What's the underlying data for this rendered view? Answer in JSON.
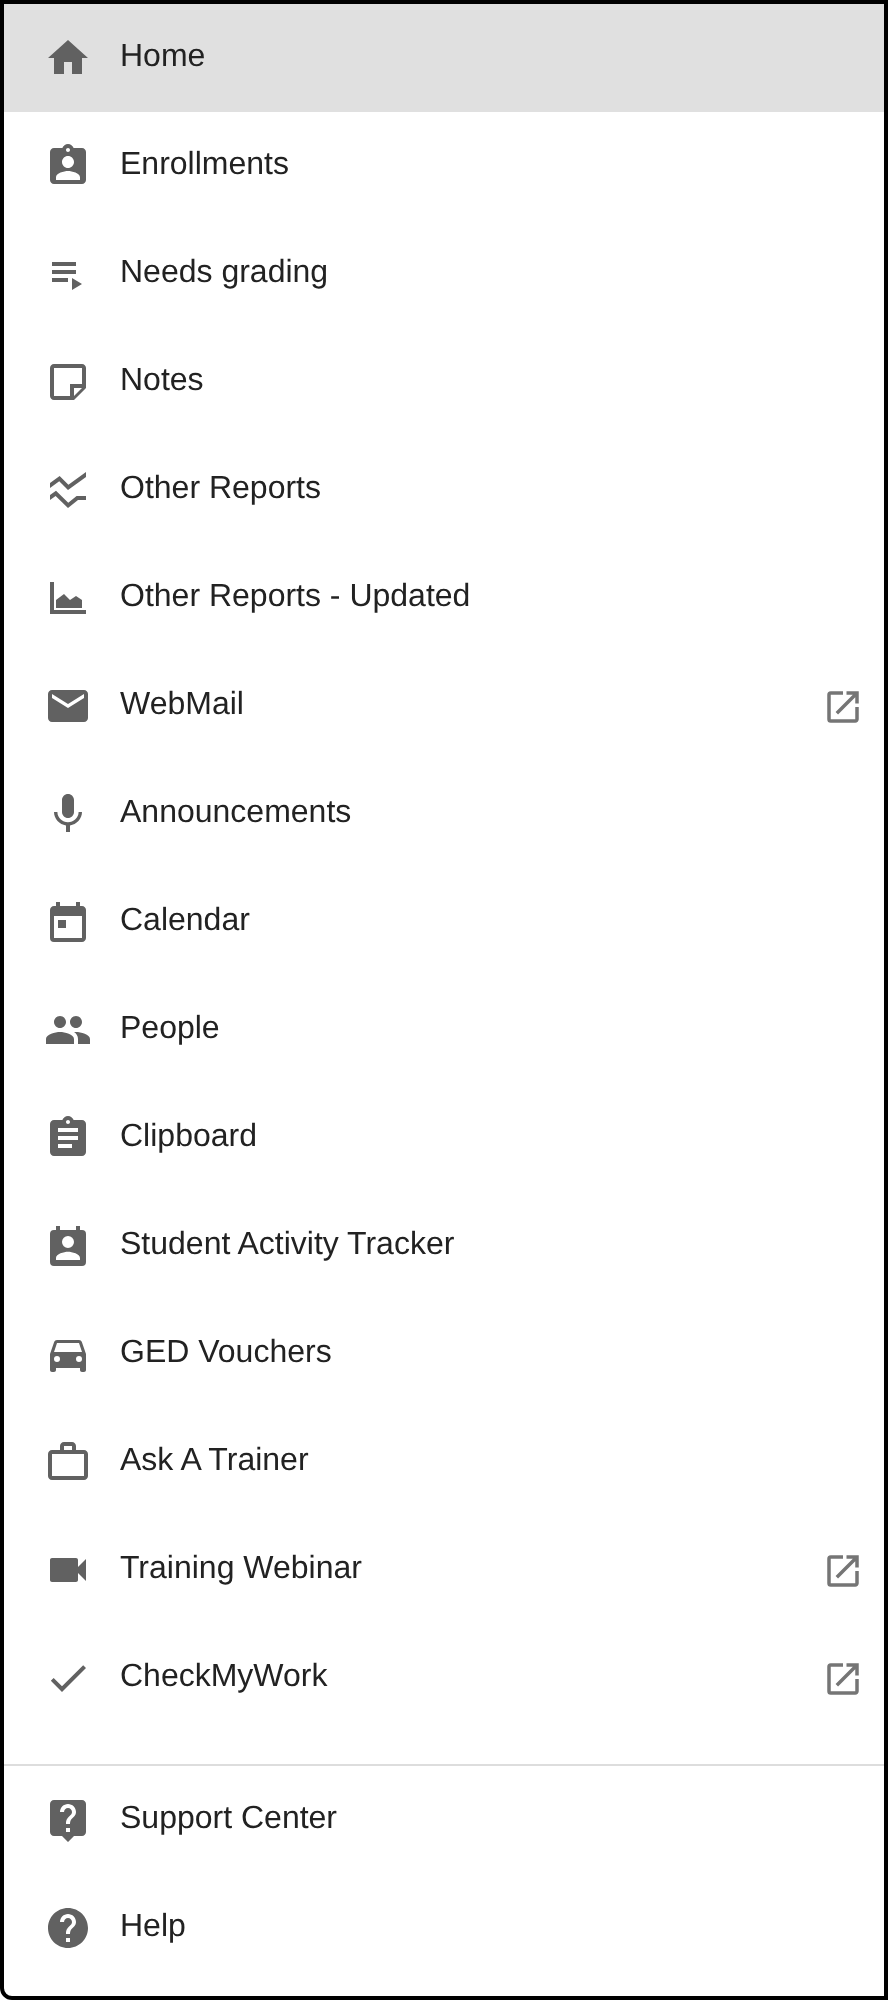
{
  "menu": [
    {
      "label": "Home",
      "selected": true,
      "external": false
    },
    {
      "label": "Enrollments",
      "selected": false,
      "external": false
    },
    {
      "label": "Needs grading",
      "selected": false,
      "external": false
    },
    {
      "label": "Notes",
      "selected": false,
      "external": false
    },
    {
      "label": "Other Reports",
      "selected": false,
      "external": false
    },
    {
      "label": "Other Reports - Updated",
      "selected": false,
      "external": false
    },
    {
      "label": "WebMail",
      "selected": false,
      "external": true
    },
    {
      "label": "Announcements",
      "selected": false,
      "external": false
    },
    {
      "label": "Calendar",
      "selected": false,
      "external": false
    },
    {
      "label": "People",
      "selected": false,
      "external": false
    },
    {
      "label": "Clipboard",
      "selected": false,
      "external": false
    },
    {
      "label": "Student Activity Tracker",
      "selected": false,
      "external": false
    },
    {
      "label": "GED Vouchers",
      "selected": false,
      "external": false
    },
    {
      "label": "Ask A Trainer",
      "selected": false,
      "external": false
    },
    {
      "label": "Training Webinar",
      "selected": false,
      "external": true
    },
    {
      "label": "CheckMyWork",
      "selected": false,
      "external": true
    }
  ],
  "footer": [
    {
      "label": "Support Center",
      "selected": false,
      "external": false
    },
    {
      "label": "Help",
      "selected": false,
      "external": false
    }
  ]
}
